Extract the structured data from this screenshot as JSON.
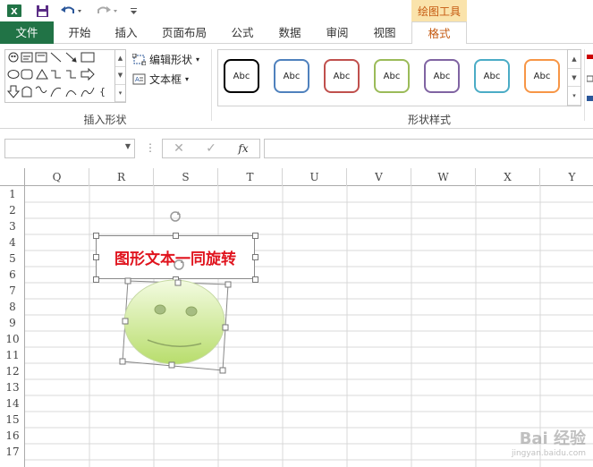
{
  "app": {
    "colors": {
      "excel_green": "#217346",
      "context_tab_bg": "#fae3ab",
      "context_tab_text": "#c55a11",
      "shape_text": "#e0141e"
    }
  },
  "titlebar": {
    "icons": [
      "excel-logo-icon",
      "save-icon",
      "undo-icon",
      "redo-icon",
      "customize-quick-access-icon"
    ],
    "contextual_tab_group": "绘图工具"
  },
  "tabs": {
    "file": "文件",
    "home": "开始",
    "insert": "插入",
    "page_layout": "页面布局",
    "formulas": "公式",
    "data": "数据",
    "review": "审阅",
    "view": "视图",
    "format": "格式"
  },
  "ribbon": {
    "insert_shapes": {
      "label": "插入形状",
      "edit_shape": "编辑形状",
      "text_box": "文本框"
    },
    "shape_styles": {
      "label": "形状样式",
      "tiles": [
        {
          "text": "Abc",
          "color": "#000000"
        },
        {
          "text": "Abc",
          "color": "#4f81bd"
        },
        {
          "text": "Abc",
          "color": "#c0504d"
        },
        {
          "text": "Abc",
          "color": "#9bbb59"
        },
        {
          "text": "Abc",
          "color": "#8064a2"
        },
        {
          "text": "Abc",
          "color": "#4bacc6"
        },
        {
          "text": "Abc",
          "color": "#f79646"
        }
      ]
    }
  },
  "formula_bar": {
    "name_box_value": "",
    "cancel_icon": "✕",
    "enter_icon": "✓",
    "fx_label": "fx",
    "formula_value": ""
  },
  "sheet": {
    "columns": [
      "Q",
      "R",
      "S",
      "T",
      "U",
      "V",
      "W",
      "X",
      "Y"
    ],
    "rows": [
      "1",
      "2",
      "3",
      "4",
      "5",
      "6",
      "7",
      "8",
      "9",
      "10",
      "11",
      "12",
      "13",
      "14",
      "15",
      "16",
      "17"
    ]
  },
  "shapes": {
    "text_box_text": "图形文本一同旋转",
    "smiley": {
      "fill_top": "#f3fbe1",
      "fill_bottom": "#b8dd6c",
      "feature_color": "#8fa764"
    }
  },
  "watermark": {
    "text": "Bai 经验",
    "url": "jingyan.baidu.com"
  }
}
